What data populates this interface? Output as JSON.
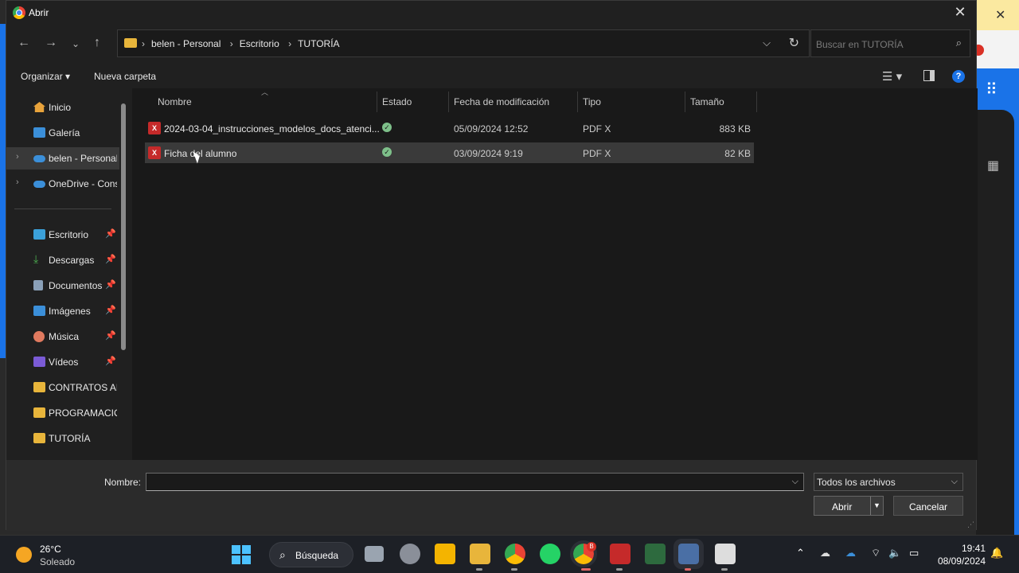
{
  "window": {
    "title": "Abrir"
  },
  "address": {
    "crumbs": [
      "belen - Personal",
      "Escritorio",
      "TUTORÍA"
    ]
  },
  "search": {
    "placeholder": "Buscar en TUTORÍA"
  },
  "commands": {
    "organize": "Organizar",
    "new_folder": "Nueva carpeta"
  },
  "sidebar": {
    "items": [
      {
        "label": "Inicio",
        "icon": "home-icon"
      },
      {
        "label": "Galería",
        "icon": "gallery-icon"
      },
      {
        "label": "belen - Personal",
        "icon": "cloud-icon"
      },
      {
        "label": "OneDrive - Cons",
        "icon": "cloud-icon"
      },
      {
        "label": "Escritorio",
        "icon": "desktop-icon"
      },
      {
        "label": "Descargas",
        "icon": "download-icon"
      },
      {
        "label": "Documentos",
        "icon": "document-icon"
      },
      {
        "label": "Imágenes",
        "icon": "image-icon"
      },
      {
        "label": "Música",
        "icon": "music-icon"
      },
      {
        "label": "Vídeos",
        "icon": "video-icon"
      },
      {
        "label": "CONTRATOS AL",
        "icon": "folder-icon"
      },
      {
        "label": "PROGRAMACIO",
        "icon": "folder-icon"
      },
      {
        "label": "TUTORÍA",
        "icon": "folder-icon"
      }
    ]
  },
  "columns": {
    "name": "Nombre",
    "state": "Estado",
    "date": "Fecha de modificación",
    "type": "Tipo",
    "size": "Tamaño"
  },
  "files": [
    {
      "name": "2024-03-04_instrucciones_modelos_docs_atenci...",
      "date": "05/09/2024 12:52",
      "type": "PDF X",
      "size": "883 KB"
    },
    {
      "name": "Ficha del alumno",
      "date": "03/09/2024 9:19",
      "type": "PDF X",
      "size": "82 KB"
    }
  ],
  "bottom": {
    "name_label": "Nombre:",
    "name_value": "",
    "filter": "Todos los archivos",
    "open": "Abrir",
    "cancel": "Cancelar"
  },
  "taskbar": {
    "temp": "26°C",
    "condition": "Soleado",
    "search": "Búsqueda",
    "time": "19:41",
    "date": "08/09/2024",
    "badge": "B"
  },
  "colors": {
    "accent": "#1a73e8",
    "dialog_bg": "#202020",
    "list_bg": "#191919",
    "selected_row": "#3a3a3a"
  }
}
